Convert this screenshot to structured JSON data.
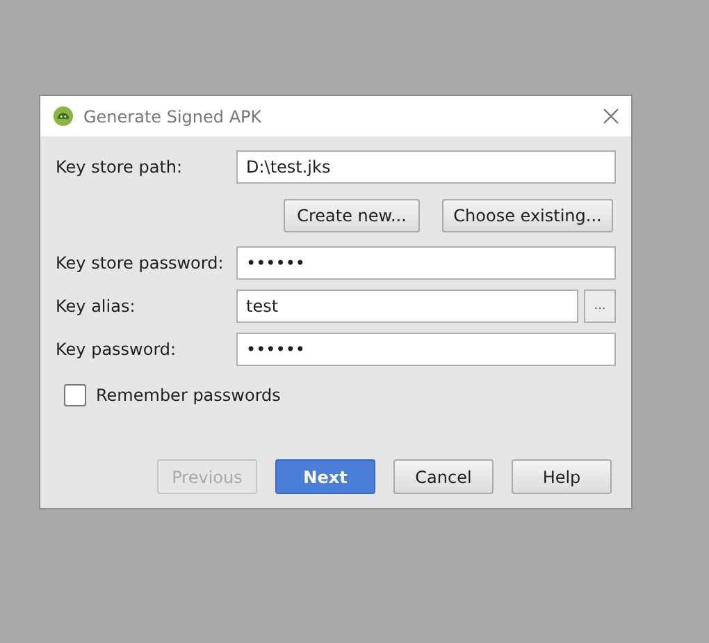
{
  "window": {
    "title": "Generate Signed APK"
  },
  "fields": [
    {
      "label": "Key store path:",
      "value": "D:\\test.jks"
    },
    {
      "kind": "buttons",
      "buttons": [
        "Create new...",
        "Choose existing..."
      ]
    },
    {
      "label": "Key store password:",
      "value": "••••••"
    },
    {
      "label": "Key alias:",
      "value": "test",
      "browse": "..."
    },
    {
      "label": "Key password:",
      "value": "••••••"
    }
  ],
  "remember": {
    "label": "Remember passwords",
    "checked": false
  },
  "buttons": [
    {
      "label": "Previous",
      "kind": "default",
      "disabled": true
    },
    {
      "label": "Next",
      "kind": "primary",
      "disabled": false
    },
    {
      "label": "Cancel",
      "kind": "default",
      "disabled": false
    },
    {
      "label": "Help",
      "kind": "default",
      "disabled": false
    }
  ]
}
